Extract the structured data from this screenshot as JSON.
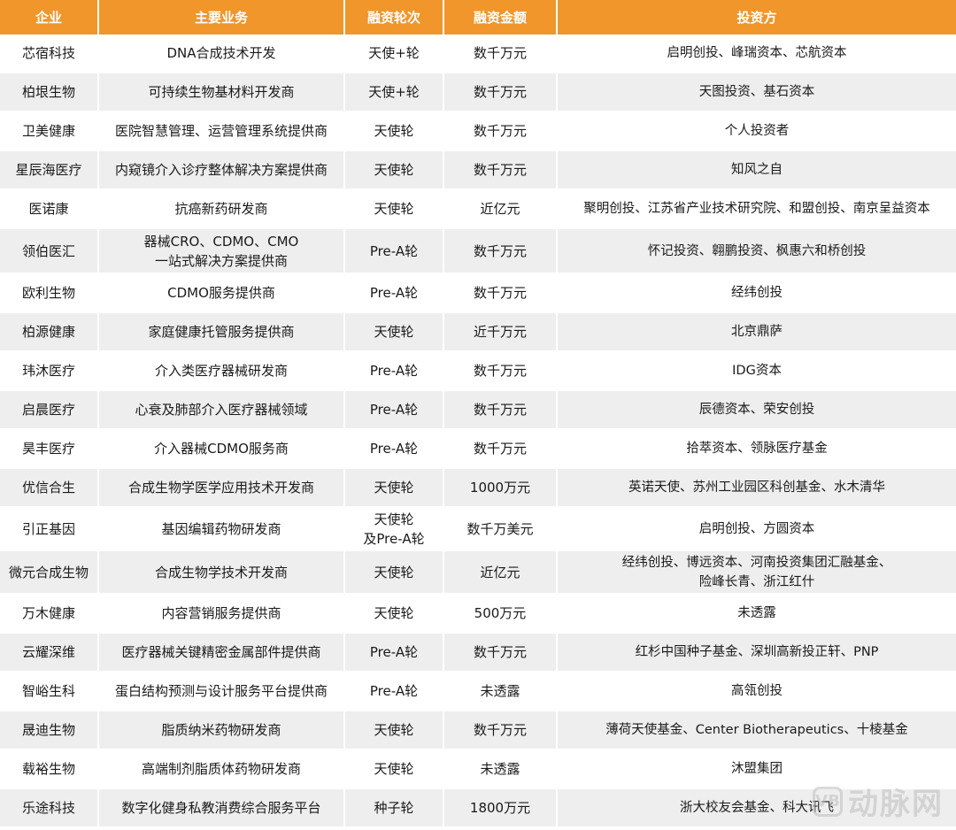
{
  "headers": [
    "企业",
    "主要业务",
    "融资轮次",
    "融资金额",
    "投资方"
  ],
  "rows": [
    {
      "company": "芯宿科技",
      "business": [
        "DNA合成技术开发"
      ],
      "round": [
        "天使+轮"
      ],
      "amount": "数千万元",
      "investors": [
        "启明创投、峰瑞资本、芯航资本"
      ]
    },
    {
      "company": "柏垠生物",
      "business": [
        "可持续生物基材料开发商"
      ],
      "round": [
        "天使+轮"
      ],
      "amount": "数千万元",
      "investors": [
        "天图投资、基石资本"
      ]
    },
    {
      "company": "卫美健康",
      "business": [
        "医院智慧管理、运营管理系统提供商"
      ],
      "round": [
        "天使轮"
      ],
      "amount": "数千万元",
      "investors": [
        "个人投资者"
      ]
    },
    {
      "company": "星辰海医疗",
      "business": [
        "内窥镜介入诊疗整体解决方案提供商"
      ],
      "round": [
        "天使轮"
      ],
      "amount": "数千万元",
      "investors": [
        "知风之自"
      ]
    },
    {
      "company": "医诺康",
      "business": [
        "抗癌新药研发商"
      ],
      "round": [
        "天使轮"
      ],
      "amount": "近亿元",
      "investors": [
        "聚明创投、江苏省产业技术研究院、和盟创投、南京呈益资本"
      ]
    },
    {
      "company": "领伯医汇",
      "business": [
        "器械CRO、CDMO、CMO",
        "一站式解决方案提供商"
      ],
      "round": [
        "Pre-A轮"
      ],
      "amount": "数千万元",
      "investors": [
        "怀记投资、翱鹏投资、枫惠六和桥创投"
      ]
    },
    {
      "company": "欧利生物",
      "business": [
        "CDMO服务提供商"
      ],
      "round": [
        "Pre-A轮"
      ],
      "amount": "数千万元",
      "investors": [
        "经纬创投"
      ]
    },
    {
      "company": "柏源健康",
      "business": [
        "家庭健康托管服务提供商"
      ],
      "round": [
        "天使轮"
      ],
      "amount": "近千万元",
      "investors": [
        "北京鼎萨"
      ]
    },
    {
      "company": "玮沐医疗",
      "business": [
        "介入类医疗器械研发商"
      ],
      "round": [
        "Pre-A轮"
      ],
      "amount": "数千万元",
      "investors": [
        "IDG资本"
      ]
    },
    {
      "company": "启晨医疗",
      "business": [
        "心衰及肺部介入医疗器械领域"
      ],
      "round": [
        "Pre-A轮"
      ],
      "amount": "数千万元",
      "investors": [
        "辰德资本、荣安创投"
      ]
    },
    {
      "company": "昊丰医疗",
      "business": [
        "介入器械CDMO服务商"
      ],
      "round": [
        "Pre-A轮"
      ],
      "amount": "数千万元",
      "investors": [
        "拾萃资本、领脉医疗基金"
      ]
    },
    {
      "company": "优信合生",
      "business": [
        "合成生物学医学应用技术开发商"
      ],
      "round": [
        "天使轮"
      ],
      "amount": "1000万元",
      "investors": [
        "英诺天使、苏州工业园区科创基金、水木清华"
      ]
    },
    {
      "company": "引正基因",
      "business": [
        "基因编辑药物研发商"
      ],
      "round": [
        "天使轮",
        "及Pre-A轮"
      ],
      "amount": "数千万美元",
      "investors": [
        "启明创投、方圆资本"
      ]
    },
    {
      "company": "微元合成生物",
      "business": [
        "合成生物学技术开发商"
      ],
      "round": [
        "天使轮"
      ],
      "amount": "近亿元",
      "investors": [
        "经纬创投、博远资本、河南投资集团汇融基金、",
        "险峰长青、浙江红什"
      ]
    },
    {
      "company": "万木健康",
      "business": [
        "内容营销服务提供商"
      ],
      "round": [
        "天使轮"
      ],
      "amount": "500万元",
      "investors": [
        "未透露"
      ]
    },
    {
      "company": "云耀深维",
      "business": [
        "医疗器械关键精密金属部件提供商"
      ],
      "round": [
        "Pre-A轮"
      ],
      "amount": "数千万元",
      "investors": [
        "红杉中国种子基金、深圳高新投正轩、PNP"
      ]
    },
    {
      "company": "智峪生科",
      "business": [
        "蛋白结构预测与设计服务平台提供商"
      ],
      "round": [
        "Pre-A轮"
      ],
      "amount": "未透露",
      "investors": [
        "高瓴创投"
      ]
    },
    {
      "company": "晟迪生物",
      "business": [
        "脂质纳米药物研发商"
      ],
      "round": [
        "天使轮"
      ],
      "amount": "数千万元",
      "investors": [
        "薄荷天使基金、Center Biotherapeutics、十棱基金"
      ]
    },
    {
      "company": "载裕生物",
      "business": [
        "高端制剂脂质体药物研发商"
      ],
      "round": [
        "天使轮"
      ],
      "amount": "未透露",
      "investors": [
        "沐盟集团"
      ]
    },
    {
      "company": "乐途科技",
      "business": [
        "数字化健身私教消费综合服务平台"
      ],
      "round": [
        "种子轮"
      ],
      "amount": "1800万元",
      "investors": [
        "浙大校友会基金、科大讯飞"
      ]
    }
  ],
  "watermark": {
    "logo_text": "VB",
    "text": "动脉网"
  }
}
